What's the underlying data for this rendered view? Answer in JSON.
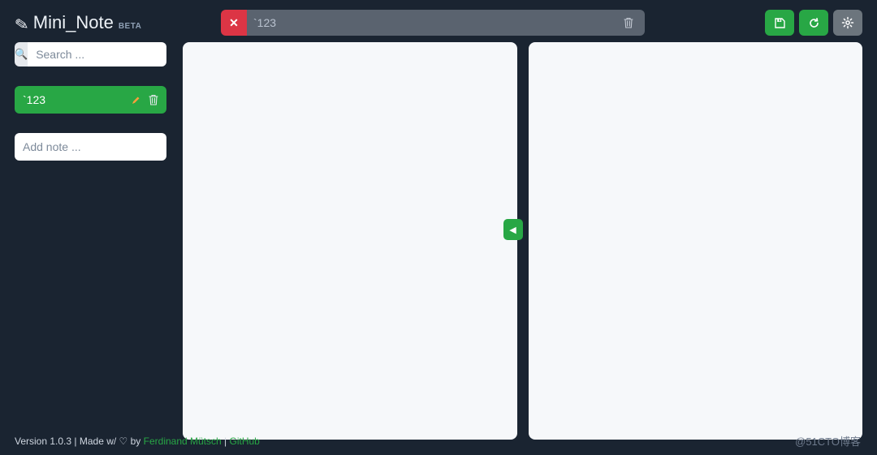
{
  "brand": {
    "title": "Mini_Note",
    "badge": "BETA"
  },
  "header": {
    "title_value": "`123",
    "save_label": "Save",
    "reload_label": "Reload",
    "settings_label": "Settings"
  },
  "sidebar": {
    "search_placeholder": "Search ...",
    "notes": [
      {
        "label": "`123"
      }
    ],
    "add_placeholder": "Add note ...",
    "add_button": "+"
  },
  "panes": {
    "collapse_label": "◀"
  },
  "footer": {
    "version_prefix": "Version ",
    "version": "1.0.3",
    "made_with": " | Made w/ ♡ by ",
    "author": "Ferdinand Mütsch",
    "sep": " | ",
    "github": "GitHub"
  },
  "watermark": "@51CTO博客",
  "colors": {
    "bg": "#1a2431",
    "accent": "#28a745",
    "danger": "#dc3545",
    "muted": "#6c757d",
    "pane": "#f6f8fa"
  }
}
